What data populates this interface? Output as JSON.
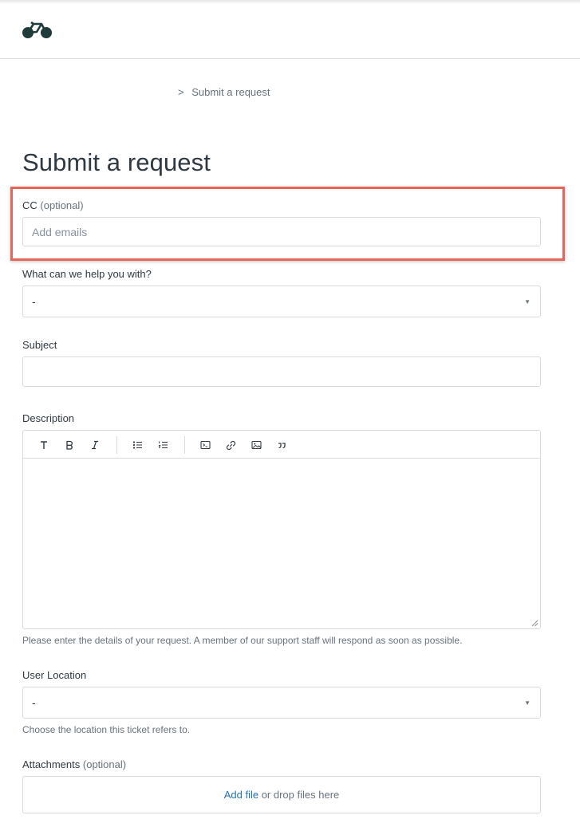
{
  "header": {
    "logo": "bicycle-logo"
  },
  "breadcrumb": {
    "separator": ">",
    "current": "Submit a request"
  },
  "page": {
    "title": "Submit a request"
  },
  "cc": {
    "label": "CC",
    "optional": "(optional)",
    "placeholder": "Add emails"
  },
  "help_with": {
    "label": "What can we help you with?",
    "value": "-"
  },
  "subject": {
    "label": "Subject",
    "value": ""
  },
  "description": {
    "label": "Description",
    "toolbar": [
      "text",
      "bold",
      "italic",
      "bulleted-list",
      "numbered-list",
      "code-block",
      "link",
      "image",
      "quote"
    ],
    "hint": "Please enter the details of your request. A member of our support staff will respond as soon as possible."
  },
  "user_location": {
    "label": "User Location",
    "value": "-",
    "hint": "Choose the location this ticket refers to."
  },
  "attachments": {
    "label": "Attachments",
    "optional": "(optional)",
    "add_file": "Add file",
    "drop_text": " or drop files here"
  },
  "colors": {
    "highlight": "#e8645a",
    "link": "#1f73b7"
  }
}
